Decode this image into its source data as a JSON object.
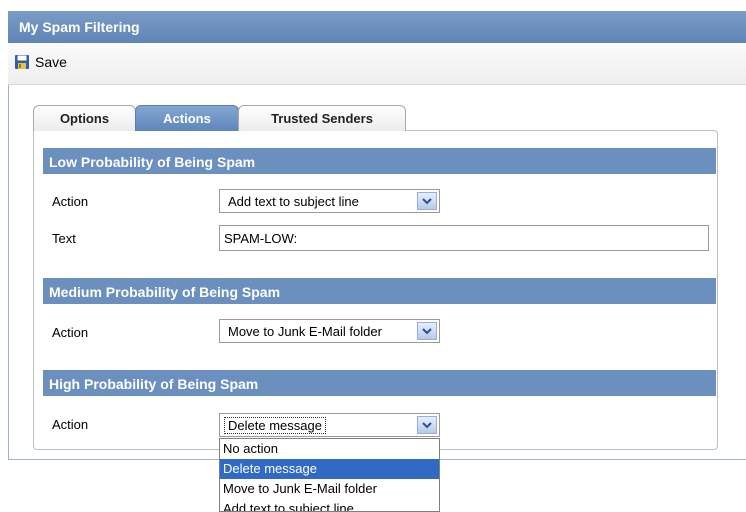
{
  "window": {
    "title": "My Spam Filtering"
  },
  "toolbar": {
    "save_label": "Save"
  },
  "tabs": [
    {
      "label": "Options",
      "active": false
    },
    {
      "label": "Actions",
      "active": true
    },
    {
      "label": "Trusted Senders",
      "active": false
    }
  ],
  "sections": {
    "low": {
      "title": "Low Probability of Being Spam",
      "action_label": "Action",
      "action_value": "Add text to subject line",
      "text_label": "Text",
      "text_value": "SPAM-LOW:"
    },
    "medium": {
      "title": "Medium Probability of Being Spam",
      "action_label": "Action",
      "action_value": "Move to Junk E-Mail folder"
    },
    "high": {
      "title": "High Probability of Being Spam",
      "action_label": "Action",
      "action_value": "Delete message",
      "options": [
        "No action",
        "Delete message",
        "Move to Junk E-Mail folder",
        "Add text to subject line"
      ],
      "highlighted_option": "Delete message"
    }
  },
  "colors": {
    "title_bar": "#6a8fc0",
    "section_header": "#6b8fbf",
    "active_tab": "#6f93c4",
    "selection": "#316ac5"
  },
  "icons": {
    "save": "floppy-disk-icon",
    "dropdown": "chevron-down-icon"
  }
}
